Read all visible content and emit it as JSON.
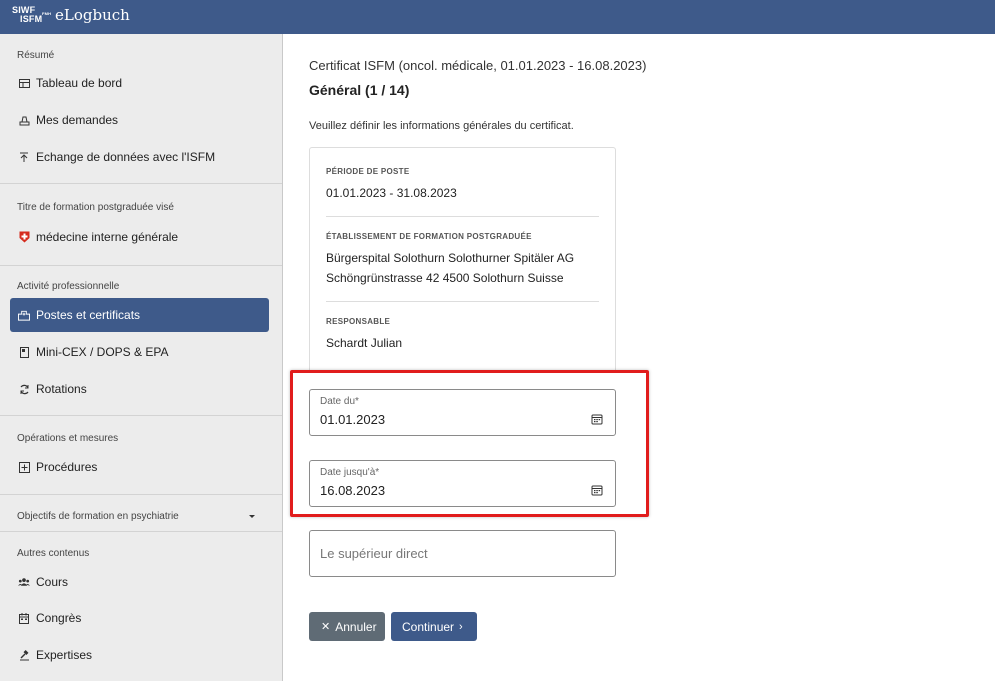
{
  "header": {
    "logo_line1": "SIWF",
    "logo_line2": "ISFM",
    "logo_fmh": "FMH",
    "app_title": "eLogbuch"
  },
  "sidebar": {
    "sections": {
      "resume": "Résumé",
      "titre": "Titre de formation postgraduée visé",
      "activite": "Activité professionnelle",
      "operations": "Opérations et mesures",
      "objectifs": "Objectifs de formation en psychiatrie",
      "autres": "Autres contenus"
    },
    "items": {
      "tableau": "Tableau de bord",
      "demandes": "Mes demandes",
      "echange": "Echange de données avec l'ISFM",
      "medecine": "médecine interne générale",
      "postes": "Postes et certificats",
      "minicex": "Mini-CEX / DOPS & EPA",
      "rotations": "Rotations",
      "procedures": "Procédures",
      "cours": "Cours",
      "congres": "Congrès",
      "expertises": "Expertises"
    },
    "active_color": "#3e5a8a"
  },
  "main": {
    "certificate": "Certificat ISFM (oncol. médicale, 01.01.2023 - 16.08.2023)",
    "section_title": "Général (1 / 14)",
    "intro": "Veuillez définir les informations générales du certificat.",
    "card": {
      "periode_label": "PÉRIODE DE POSTE",
      "periode_value": "01.01.2023 - 31.08.2023",
      "etab_label": "ÉTABLISSEMENT DE FORMATION POSTGRADUÉE",
      "etab_line1": "Bürgerspital Solothurn Solothurner Spitäler AG",
      "etab_line2": "Schöngrünstrasse 42 4500 Solothurn Suisse",
      "resp_label": "RESPONSABLE",
      "resp_value": "Schardt Julian"
    },
    "date_from": {
      "label": "Date du*",
      "value": "01.01.2023"
    },
    "date_to": {
      "label": "Date jusqu'à*",
      "value": "16.08.2023"
    },
    "superior": {
      "placeholder": "Le supérieur direct"
    },
    "buttons": {
      "cancel": "Annuler",
      "next": "Continuer"
    },
    "highlight_color": "#e11c1c"
  }
}
